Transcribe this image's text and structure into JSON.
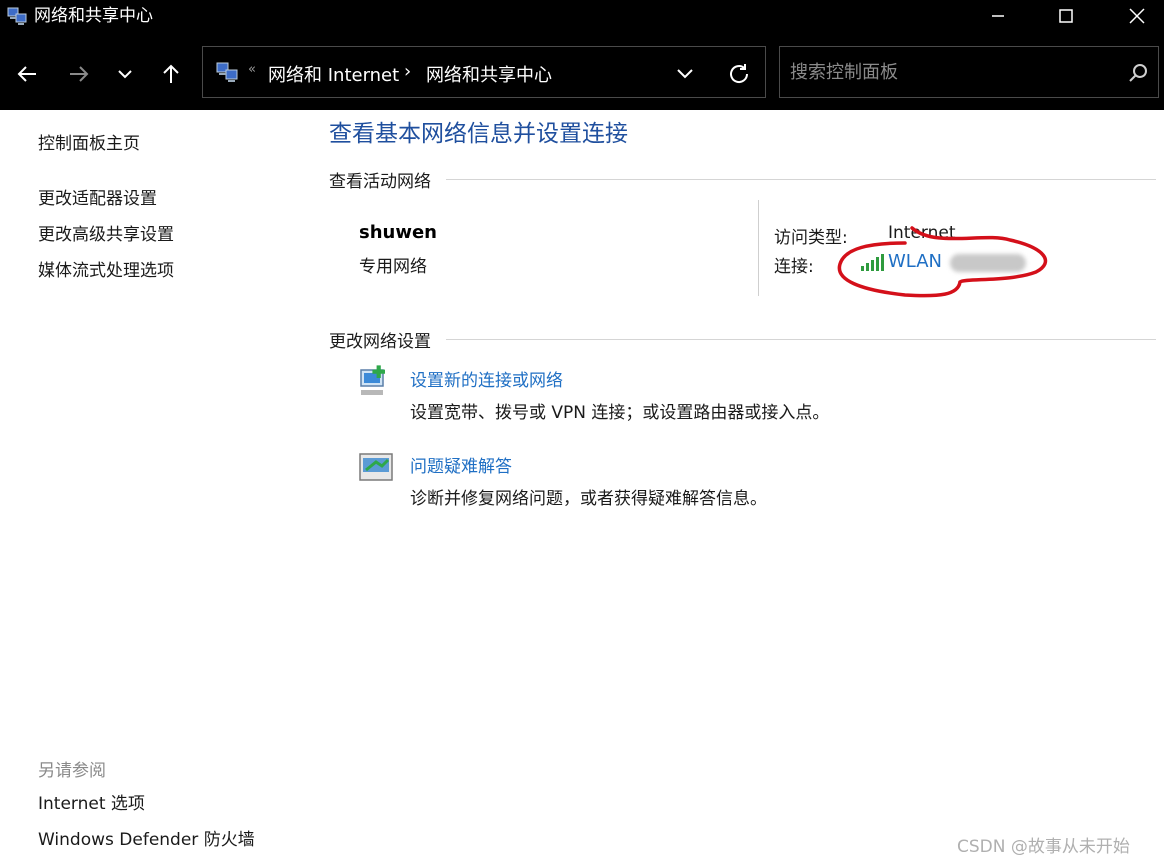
{
  "window": {
    "title": "网络和共享中心",
    "icons": {
      "app": "network-center-icon",
      "minimize": "minimize-icon",
      "maximize": "maximize-icon",
      "close": "close-icon"
    }
  },
  "nav": {
    "icons": {
      "back": "back-arrow-icon",
      "forward": "forward-arrow-icon",
      "recent": "chevron-down-icon",
      "up": "up-arrow-icon",
      "refresh": "refresh-icon",
      "search": "search-icon"
    },
    "address": {
      "overflow": "«",
      "crumbs": [
        "网络和 Internet",
        "网络和共享中心"
      ],
      "separator": "›"
    },
    "search_placeholder": "搜索控制面板"
  },
  "sidebar": {
    "home": "控制面板主页",
    "items": [
      "更改适配器设置",
      "更改高级共享设置",
      "媒体流式处理选项"
    ],
    "see_also_title": "另请参阅",
    "see_also": [
      "Internet 选项",
      "Windows Defender 防火墙"
    ]
  },
  "main": {
    "title": "查看基本网络信息并设置连接",
    "active_section": "查看活动网络",
    "network": {
      "name": "shuwen",
      "type": "专用网络",
      "access_label": "访问类型:",
      "access_value": "Internet",
      "connection_label": "连接:",
      "connection_value": "WLAN",
      "signal_icon": "wifi-signal-icon"
    },
    "change_section": "更改网络设置",
    "tasks": [
      {
        "icon": "new-connection-icon",
        "label": "设置新的连接或网络",
        "desc": "设置宽带、拨号或 VPN 连接；或设置路由器或接入点。"
      },
      {
        "icon": "troubleshoot-icon",
        "label": "问题疑难解答",
        "desc": "诊断并修复网络问题，或者获得疑难解答信息。"
      }
    ]
  },
  "watermark": "CSDN @故事从未开始",
  "colors": {
    "titlebar": "#000000",
    "heading": "#1f4f9e",
    "link": "#1f6fc4",
    "annotation": "#d4101a"
  }
}
